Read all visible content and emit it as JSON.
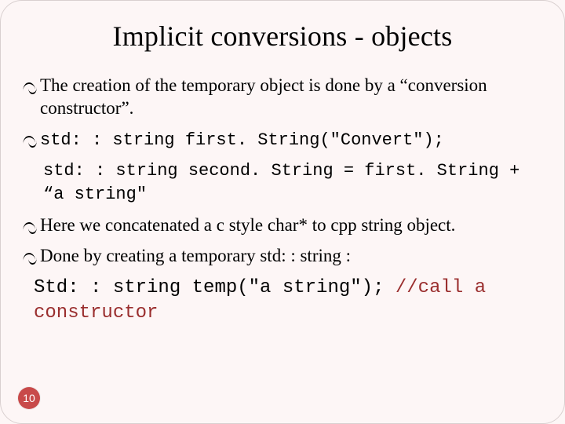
{
  "title": "Implicit conversions - objects",
  "bullets": {
    "b1": "The creation of the temporary object is done by a “conversion constructor”.",
    "b2_code": "std: : string  first. String(\"Convert\");",
    "b2_sub_code": "std: : string  second. String = first. String + “a string\"",
    "b3": "Here we concatenated a c style char* to cpp string object.",
    "b4": "Done by creating a temporary std: : string :"
  },
  "code_block": {
    "line1_a": "Std: : string temp(\"a string\"); ",
    "line1_b": "//call a",
    "line2": "constructor"
  },
  "page_number": "10"
}
